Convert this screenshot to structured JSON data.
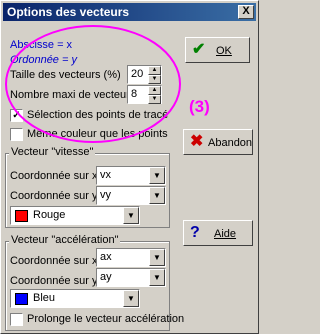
{
  "window": {
    "title": "Options des vecteurs",
    "close_label": "X"
  },
  "top": {
    "abscisse": "Abscisse = x",
    "ordonnee": "Ordonnée = y",
    "taille_label": "Taille des vecteurs (%)",
    "taille_value": "20",
    "nombre_label": "Nombre maxi de vecteurs",
    "nombre_value": "8",
    "selection_label": "Sélection des points de tracé",
    "selection_checked": true,
    "meme_couleur_label": "Même couleur que les points",
    "meme_couleur_checked": false
  },
  "annotation": {
    "text": "(3)",
    "color": "#ff00ff"
  },
  "vitesse": {
    "group_label": "Vecteur \"vitesse\"",
    "coord_x_label": "Coordonnée sur x",
    "coord_x_value": "vx",
    "coord_y_label": "Coordonnée sur y",
    "coord_y_value": "vy",
    "color_value": "Rouge",
    "color_hex": "#ff0000"
  },
  "acceleration": {
    "group_label": "Vecteur \"accélération\"",
    "coord_x_label": "Coordonnée sur x",
    "coord_x_value": "ax",
    "coord_y_label": "Coordonnée sur y",
    "coord_y_value": "ay",
    "color_value": "Bleu",
    "color_hex": "#0000ff",
    "prolonge_label": "Prolonge le vecteur accélération",
    "prolonge_checked": false
  },
  "buttons": {
    "ok_label": "OK",
    "ok_icon": "checkmark-icon",
    "abandon_label": "Abandon",
    "abandon_icon": "x-mark-icon",
    "aide_label": "Aide",
    "aide_icon": "question-mark-icon"
  }
}
